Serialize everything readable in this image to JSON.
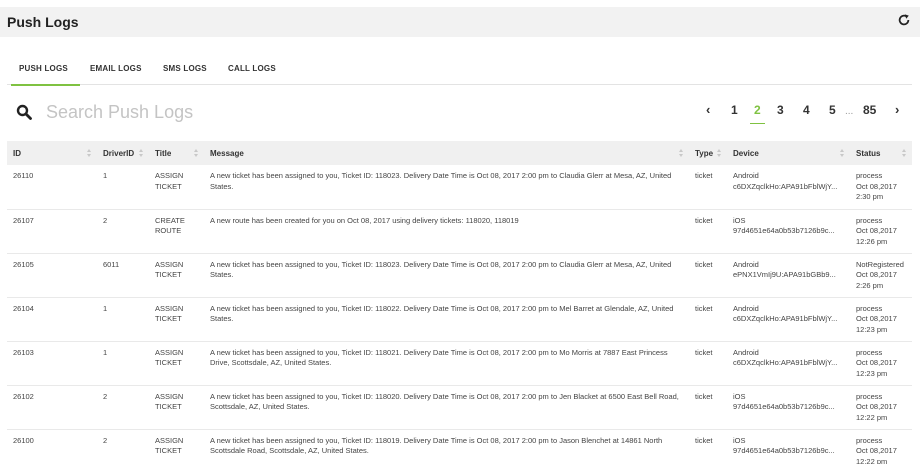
{
  "header": {
    "title": "Push Logs",
    "refresh_icon": "refresh-icon"
  },
  "tabs": [
    {
      "label": "PUSH LOGS",
      "active": true
    },
    {
      "label": "EMAIL LOGS",
      "active": false
    },
    {
      "label": "SMS LOGS",
      "active": false
    },
    {
      "label": "CALL LOGS",
      "active": false
    }
  ],
  "search": {
    "placeholder": "Search Push Logs",
    "value": "",
    "icon": "search-icon"
  },
  "pagination": {
    "prev": "‹",
    "pages": [
      "1",
      "2",
      "3",
      "4",
      "5"
    ],
    "current": "2",
    "ellipsis": "...",
    "last": "85",
    "next": "›"
  },
  "table": {
    "columns": [
      "ID",
      "DriverID",
      "Title",
      "Message",
      "Type",
      "Device",
      "Status"
    ],
    "rows": [
      {
        "id": "26110",
        "driver": "1",
        "title": [
          "ASSIGN",
          "TICKET"
        ],
        "message": "A new ticket has been assigned to you, Ticket ID: 118023. Delivery Date Time is Oct 08, 2017 2:00 pm to Claudia Glerr at Mesa, AZ, United States.",
        "type": "ticket",
        "device": [
          "Android",
          "c6DXZqclkHo:APA91bFblWjY..."
        ],
        "status": [
          "process",
          "Oct 08,2017",
          "2:30 pm"
        ]
      },
      {
        "id": "26107",
        "driver": "2",
        "title": [
          "CREATE",
          "ROUTE"
        ],
        "message": "A new route has been created for you on Oct 08, 2017 using delivery tickets: 118020, 118019",
        "type": "ticket",
        "device": [
          "iOS",
          "97d4651e64a0b53b7126b9c..."
        ],
        "status": [
          "process",
          "Oct 08,2017",
          "12:26 pm"
        ]
      },
      {
        "id": "26105",
        "driver": "6011",
        "title": [
          "ASSIGN",
          "TICKET"
        ],
        "message": "A new ticket has been assigned to you, Ticket ID: 118023. Delivery Date Time is Oct 08, 2017 2:00 pm to Claudia Glerr at Mesa, AZ, United States.",
        "type": "ticket",
        "device": [
          "Android",
          "ePNX1VmIj9U:APA91bGBb9..."
        ],
        "status": [
          "NotRegistered",
          "Oct 08,2017",
          "2:26 pm"
        ]
      },
      {
        "id": "26104",
        "driver": "1",
        "title": [
          "ASSIGN",
          "TICKET"
        ],
        "message": "A new ticket has been assigned to you, Ticket ID: 118022. Delivery Date Time is Oct 08, 2017 2:00 pm to Mel Barret at Glendale, AZ, United States.",
        "type": "ticket",
        "device": [
          "Android",
          "c6DXZqclkHo:APA91bFblWjY..."
        ],
        "status": [
          "process",
          "Oct 08,2017",
          "12:23 pm"
        ]
      },
      {
        "id": "26103",
        "driver": "1",
        "title": [
          "ASSIGN",
          "TICKET"
        ],
        "message": "A new ticket has been assigned to you, Ticket ID: 118021. Delivery Date Time is Oct 08, 2017 2:00 pm to Mo Morris at 7887 East Princess Drive, Scottsdale, AZ, United States.",
        "type": "ticket",
        "device": [
          "Android",
          "c6DXZqclkHo:APA91bFblWjY..."
        ],
        "status": [
          "process",
          "Oct 08,2017",
          "12:23 pm"
        ]
      },
      {
        "id": "26102",
        "driver": "2",
        "title": [
          "ASSIGN",
          "TICKET"
        ],
        "message": "A new ticket has been assigned to you, Ticket ID: 118020. Delivery Date Time is Oct 08, 2017 2:00 pm to Jen Blacket at 6500 East Bell Road, Scottsdale, AZ, United States.",
        "type": "ticket",
        "device": [
          "iOS",
          "97d4651e64a0b53b7126b9c..."
        ],
        "status": [
          "process",
          "Oct 08,2017",
          "12:22 pm"
        ]
      },
      {
        "id": "26100",
        "driver": "2",
        "title": [
          "ASSIGN",
          "TICKET"
        ],
        "message": "A new ticket has been assigned to you, Ticket ID: 118019. Delivery Date Time is Oct 08, 2017 2:00 pm to Jason Blenchet at 14861 North Scottsdale Road, Scottsdale, AZ, United States.",
        "type": "ticket",
        "device": [
          "iOS",
          "97d4651e64a0b53b7126b9c..."
        ],
        "status": [
          "process",
          "Oct 08,2017",
          "12:22 pm"
        ]
      }
    ]
  }
}
